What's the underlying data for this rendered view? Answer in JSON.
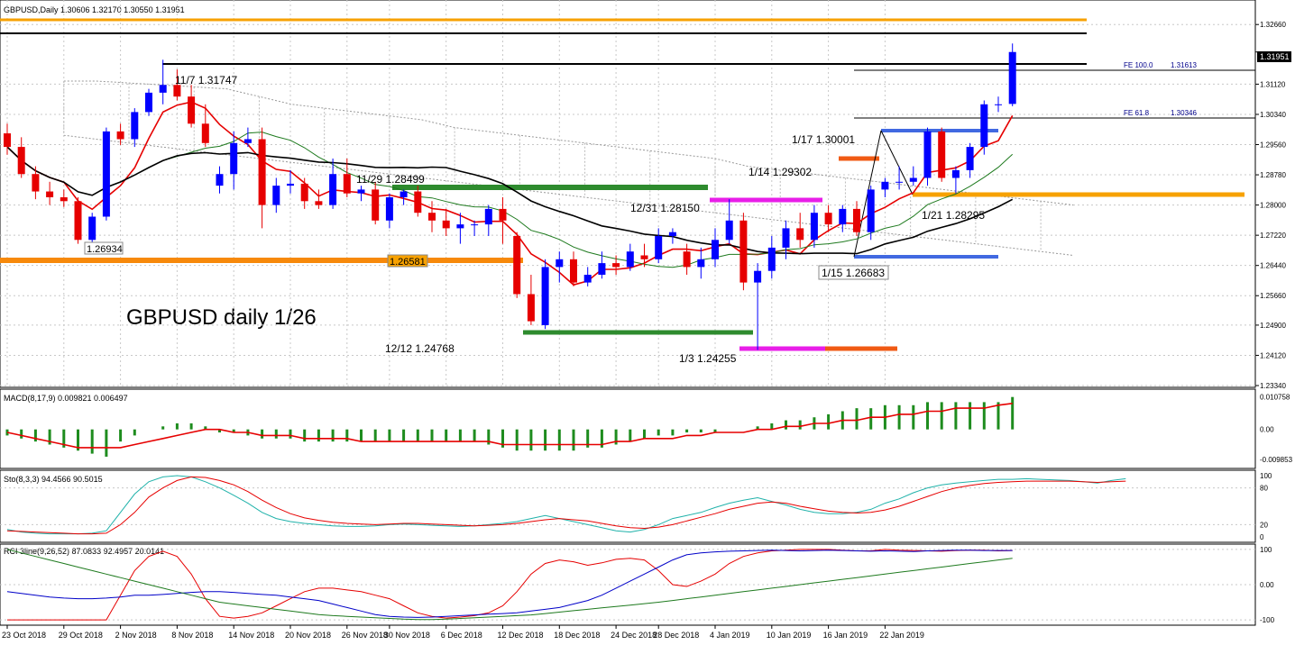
{
  "chart_data": [
    {
      "type": "candlestick",
      "title": "GBPUSD,Daily  1.30606 1.32170 1.30550 1.31951",
      "annotation_main": "GBPUSD daily 1/26",
      "ylim": [
        1.2334,
        1.3306
      ],
      "yticks": [
        "1.32660",
        "1.31951",
        "1.31120",
        "1.30340",
        "1.29560",
        "1.28780",
        "1.28000",
        "1.27220",
        "1.26440",
        "1.25660",
        "1.24900",
        "1.24120",
        "1.23340"
      ],
      "current_price": "1.31951",
      "x_labels": [
        "23 Oct 2018",
        "29 Oct 2018",
        "2 Nov 2018",
        "8 Nov 2018",
        "14 Nov 2018",
        "20 Nov 2018",
        "26 Nov 2018",
        "30 Nov 2018",
        "6 Dec 2018",
        "12 Dec 2018",
        "18 Dec 2018",
        "24 Dec 2018",
        "28 Dec 2018",
        "4 Jan 2019",
        "10 Jan 2019",
        "16 Jan 2019",
        "22 Jan 2019"
      ],
      "x_label_index": [
        0,
        4,
        8,
        12,
        16,
        20,
        24,
        27,
        31,
        35,
        39,
        43,
        46,
        50,
        54,
        58,
        62
      ],
      "candles": [
        [
          1.2985,
          1.301,
          1.293,
          1.295
        ],
        [
          1.295,
          1.2975,
          1.287,
          1.288
        ],
        [
          1.288,
          1.29,
          1.2815,
          1.2835
        ],
        [
          1.2835,
          1.286,
          1.28,
          1.282
        ],
        [
          1.282,
          1.284,
          1.2795,
          1.281
        ],
        [
          1.281,
          1.282,
          1.27,
          1.271
        ],
        [
          1.271,
          1.278,
          1.2693,
          1.277
        ],
        [
          1.277,
          1.3,
          1.276,
          1.299
        ],
        [
          1.299,
          1.301,
          1.2955,
          1.297
        ],
        [
          1.297,
          1.305,
          1.295,
          1.304
        ],
        [
          1.304,
          1.31,
          1.303,
          1.309
        ],
        [
          1.309,
          1.3175,
          1.306,
          1.311
        ],
        [
          1.311,
          1.315,
          1.307,
          1.308
        ],
        [
          1.308,
          1.311,
          1.3,
          1.301
        ],
        [
          1.301,
          1.306,
          1.295,
          1.296
        ],
        [
          1.285,
          1.29,
          1.283,
          1.288
        ],
        [
          1.288,
          1.299,
          1.284,
          1.296
        ],
        [
          1.296,
          1.3,
          1.295,
          1.297
        ],
        [
          1.297,
          1.3,
          1.274,
          1.28
        ],
        [
          1.28,
          1.287,
          1.278,
          1.285
        ],
        [
          1.285,
          1.289,
          1.283,
          1.2855
        ],
        [
          1.2855,
          1.287,
          1.279,
          1.281
        ],
        [
          1.281,
          1.284,
          1.279,
          1.28
        ],
        [
          1.28,
          1.292,
          1.279,
          1.288
        ],
        [
          1.288,
          1.292,
          1.282,
          1.283
        ],
        [
          1.283,
          1.285,
          1.281,
          1.284
        ],
        [
          1.284,
          1.286,
          1.275,
          1.276
        ],
        [
          1.276,
          1.283,
          1.274,
          1.282
        ],
        [
          1.282,
          1.284,
          1.28,
          1.2835
        ],
        [
          1.2835,
          1.285,
          1.277,
          1.278
        ],
        [
          1.278,
          1.281,
          1.273,
          1.276
        ],
        [
          1.276,
          1.279,
          1.272,
          1.274
        ],
        [
          1.274,
          1.278,
          1.27,
          1.275
        ],
        [
          1.275,
          1.276,
          1.272,
          1.275
        ],
        [
          1.275,
          1.28,
          1.272,
          1.279
        ],
        [
          1.279,
          1.282,
          1.27,
          1.276
        ],
        [
          1.272,
          1.273,
          1.256,
          1.257
        ],
        [
          1.257,
          1.262,
          1.249,
          1.25
        ],
        [
          1.249,
          1.266,
          1.248,
          1.264
        ],
        [
          1.264,
          1.268,
          1.26,
          1.266
        ],
        [
          1.266,
          1.268,
          1.259,
          1.26
        ],
        [
          1.26,
          1.264,
          1.259,
          1.262
        ],
        [
          1.262,
          1.268,
          1.261,
          1.265
        ],
        [
          1.265,
          1.267,
          1.262,
          1.264
        ],
        [
          1.264,
          1.27,
          1.263,
          1.268
        ],
        [
          1.267,
          1.27,
          1.264,
          1.266
        ],
        [
          1.266,
          1.274,
          1.265,
          1.272
        ],
        [
          1.272,
          1.274,
          1.27,
          1.273
        ],
        [
          1.268,
          1.27,
          1.262,
          1.264
        ],
        [
          1.264,
          1.269,
          1.261,
          1.266
        ],
        [
          1.266,
          1.274,
          1.264,
          1.271
        ],
        [
          1.271,
          1.2815,
          1.27,
          1.276
        ],
        [
          1.276,
          1.278,
          1.258,
          1.26
        ],
        [
          1.26,
          1.265,
          1.2426,
          1.263
        ],
        [
          1.263,
          1.272,
          1.261,
          1.269
        ],
        [
          1.269,
          1.276,
          1.266,
          1.274
        ],
        [
          1.274,
          1.278,
          1.269,
          1.271
        ],
        [
          1.271,
          1.28,
          1.269,
          1.278
        ],
        [
          1.278,
          1.28,
          1.273,
          1.275
        ],
        [
          1.275,
          1.28,
          1.273,
          1.279
        ],
        [
          1.279,
          1.281,
          1.272,
          1.273
        ],
        [
          1.273,
          1.285,
          1.271,
          1.284
        ],
        [
          1.284,
          1.287,
          1.282,
          1.286
        ],
        [
          1.286,
          1.29,
          1.284,
          1.286
        ],
        [
          1.286,
          1.29,
          1.285,
          1.287
        ],
        [
          1.287,
          1.3,
          1.285,
          1.299
        ],
        [
          1.299,
          1.3,
          1.286,
          1.287
        ],
        [
          1.287,
          1.29,
          1.283,
          1.289
        ],
        [
          1.289,
          1.296,
          1.287,
          1.295
        ],
        [
          1.295,
          1.307,
          1.293,
          1.306
        ],
        [
          1.306,
          1.308,
          1.304,
          1.306
        ],
        [
          1.3061,
          1.3217,
          1.3055,
          1.3195
        ]
      ],
      "ichimoku_cloud": {
        "upper": [
          1.312,
          1.312,
          1.3115,
          1.311,
          1.3105,
          1.31,
          1.308,
          1.306,
          1.305,
          1.304,
          1.303,
          1.302,
          1.3,
          1.299,
          1.298,
          1.297,
          1.296,
          1.295,
          1.294,
          1.293,
          1.292,
          1.29,
          1.289,
          1.288,
          1.287,
          1.286,
          1.285,
          1.284,
          1.283,
          1.282,
          1.281,
          1.28
        ],
        "lower": [
          1.298,
          1.297,
          1.296,
          1.295,
          1.294,
          1.293,
          1.292,
          1.291,
          1.29,
          1.289,
          1.288,
          1.287,
          1.286,
          1.285,
          1.284,
          1.283,
          1.282,
          1.281,
          1.28,
          1.279,
          1.278,
          1.277,
          1.276,
          1.275,
          1.274,
          1.273,
          1.272,
          1.271,
          1.27,
          1.269,
          1.268,
          1.267
        ]
      },
      "levels": [
        {
          "label": "11/7 1.31747",
          "value": 1.31747
        },
        {
          "label": "11/29 1.28499",
          "value": 1.28499
        },
        {
          "label": "12/12 1.24768",
          "value": 1.24768
        },
        {
          "label": "12/31 1.28150",
          "value": 1.2815
        },
        {
          "label": "1/3 1.24255",
          "value": 1.24255
        },
        {
          "label": "1/14 1.29302",
          "value": 1.29302
        },
        {
          "label": "1/15 1.26683",
          "value": 1.26683
        },
        {
          "label": "1/17 1.30001",
          "value": 1.30001
        },
        {
          "label": "1/21 1.28295",
          "value": 1.28295
        },
        {
          "label": "1.26934",
          "value": 1.26934
        },
        {
          "label": "1.26581",
          "value": 1.26581
        }
      ],
      "fib_labels": [
        {
          "name": "FE 100.0",
          "value": "1.31613"
        },
        {
          "name": "FE 61.8",
          "value": "1.30346"
        }
      ]
    },
    {
      "type": "histogram",
      "title": "MACD(8,17,9) 0.009821 0.006497",
      "yticks": [
        "0.010758",
        "0.00",
        "-0.009853"
      ],
      "ylim": [
        -0.0105,
        0.0115
      ],
      "values": [
        -0.002,
        -0.003,
        -0.004,
        -0.005,
        -0.006,
        -0.007,
        -0.008,
        -0.009,
        -0.004,
        -0.002,
        0.0,
        0.001,
        0.002,
        0.002,
        0.001,
        -0.001,
        -0.001,
        -0.002,
        -0.003,
        -0.003,
        -0.003,
        -0.004,
        -0.004,
        -0.004,
        -0.004,
        -0.004,
        -0.004,
        -0.004,
        -0.004,
        -0.004,
        -0.004,
        -0.004,
        -0.004,
        -0.004,
        -0.005,
        -0.006,
        -0.007,
        -0.007,
        -0.007,
        -0.007,
        -0.007,
        -0.006,
        -0.006,
        -0.005,
        -0.004,
        -0.003,
        -0.002,
        -0.002,
        -0.001,
        -0.001,
        -0.001,
        0.0,
        0.0,
        0.001,
        0.002,
        0.003,
        0.003,
        0.004,
        0.005,
        0.006,
        0.007,
        0.007,
        0.008,
        0.008,
        0.008,
        0.009,
        0.009,
        0.009,
        0.009,
        0.009,
        0.009,
        0.0107
      ],
      "signal": [
        -0.001,
        -0.002,
        -0.003,
        -0.004,
        -0.005,
        -0.006,
        -0.006,
        -0.006,
        -0.006,
        -0.005,
        -0.004,
        -0.003,
        -0.002,
        -0.001,
        0.0,
        0.0,
        -0.001,
        -0.001,
        -0.002,
        -0.002,
        -0.002,
        -0.003,
        -0.003,
        -0.003,
        -0.003,
        -0.004,
        -0.004,
        -0.004,
        -0.004,
        -0.004,
        -0.004,
        -0.004,
        -0.004,
        -0.004,
        -0.004,
        -0.005,
        -0.005,
        -0.005,
        -0.005,
        -0.005,
        -0.005,
        -0.005,
        -0.005,
        -0.004,
        -0.004,
        -0.003,
        -0.003,
        -0.003,
        -0.002,
        -0.002,
        -0.001,
        -0.001,
        -0.001,
        0.0,
        0.0,
        0.001,
        0.001,
        0.002,
        0.002,
        0.003,
        0.003,
        0.004,
        0.004,
        0.005,
        0.005,
        0.006,
        0.006,
        0.007,
        0.007,
        0.007,
        0.008,
        0.0086
      ]
    },
    {
      "type": "line",
      "title": "Sto(8,3,3) 94.4566 90.5015",
      "yticks": [
        "100",
        "80",
        "20",
        "0"
      ],
      "ylim": [
        0,
        100
      ],
      "series": [
        {
          "values": [
            12,
            8,
            6,
            5,
            5,
            5,
            6,
            10,
            40,
            70,
            90,
            98,
            100,
            98,
            90,
            80,
            68,
            55,
            40,
            30,
            25,
            22,
            20,
            18,
            17,
            17,
            18,
            20,
            21,
            20,
            19,
            18,
            17,
            18,
            20,
            22,
            25,
            30,
            35,
            30,
            25,
            20,
            15,
            10,
            8,
            12,
            20,
            30,
            35,
            40,
            48,
            55,
            60,
            64,
            58,
            52,
            45,
            40,
            38,
            38,
            40,
            45,
            55,
            62,
            72,
            80,
            85,
            88,
            90,
            92,
            94,
            94,
            95,
            94,
            93,
            92,
            90,
            88,
            92,
            95
          ]
        },
        {
          "values": [
            10,
            9,
            8,
            7,
            6,
            5,
            5,
            6,
            20,
            40,
            65,
            80,
            92,
            98,
            97,
            92,
            85,
            74,
            60,
            48,
            38,
            31,
            27,
            24,
            22,
            21,
            20,
            21,
            22,
            22,
            21,
            20,
            19,
            18,
            19,
            20,
            22,
            25,
            28,
            30,
            28,
            26,
            22,
            18,
            15,
            14,
            16,
            20,
            26,
            32,
            38,
            45,
            50,
            55,
            57,
            55,
            50,
            46,
            42,
            40,
            39,
            40,
            44,
            50,
            58,
            66,
            74,
            80,
            84,
            87,
            89,
            90,
            91,
            91,
            91,
            91,
            90,
            89,
            90,
            91
          ]
        }
      ]
    },
    {
      "type": "line",
      "title": "RCI 3line(9,26,52) 87.0833 92.4957 20.0141",
      "yticks": [
        "100",
        "0.00",
        "-100"
      ],
      "ylim": [
        -110,
        110
      ],
      "series": [
        {
          "values": [
            -100,
            -100,
            -100,
            -100,
            -100,
            -100,
            -100,
            -100,
            -30,
            40,
            80,
            95,
            80,
            30,
            -40,
            -90,
            -95,
            -90,
            -80,
            -60,
            -40,
            -20,
            -10,
            -10,
            -15,
            -20,
            -30,
            -40,
            -60,
            -80,
            -90,
            -95,
            -92,
            -88,
            -80,
            -60,
            -20,
            30,
            60,
            70,
            65,
            55,
            62,
            72,
            75,
            70,
            40,
            0,
            -5,
            10,
            30,
            60,
            80,
            90,
            96,
            98,
            100,
            100,
            100,
            98,
            96,
            96,
            100,
            98,
            97,
            96,
            95,
            97,
            98,
            98,
            96,
            97
          ]
        },
        {
          "values": [
            -20,
            -25,
            -30,
            -35,
            -38,
            -40,
            -40,
            -38,
            -35,
            -30,
            -30,
            -28,
            -25,
            -22,
            -20,
            -20,
            -22,
            -25,
            -28,
            -30,
            -35,
            -40,
            -45,
            -55,
            -65,
            -75,
            -85,
            -90,
            -92,
            -93,
            -92,
            -90,
            -88,
            -86,
            -84,
            -82,
            -80,
            -75,
            -70,
            -65,
            -55,
            -45,
            -30,
            -10,
            10,
            30,
            50,
            70,
            85,
            90,
            93,
            95,
            96,
            97,
            98,
            97,
            96,
            97,
            98,
            97,
            96,
            95,
            96,
            95,
            94,
            96,
            97,
            98,
            98,
            97,
            97,
            97
          ]
        },
        {
          "values": [
            100,
            90,
            80,
            70,
            60,
            50,
            40,
            30,
            20,
            10,
            0,
            -10,
            -20,
            -30,
            -40,
            -50,
            -55,
            -60,
            -65,
            -70,
            -75,
            -80,
            -85,
            -88,
            -90,
            -92,
            -94,
            -96,
            -98,
            -99,
            -99,
            -98,
            -96,
            -94,
            -92,
            -90,
            -88,
            -86,
            -82,
            -78,
            -74,
            -70,
            -66,
            -62,
            -58,
            -54,
            -50,
            -45,
            -40,
            -35,
            -30,
            -25,
            -20,
            -15,
            -10,
            -5,
            0,
            5,
            10,
            15,
            20,
            25,
            30,
            35,
            40,
            45,
            50,
            55,
            60,
            65,
            70,
            75
          ]
        }
      ]
    }
  ]
}
